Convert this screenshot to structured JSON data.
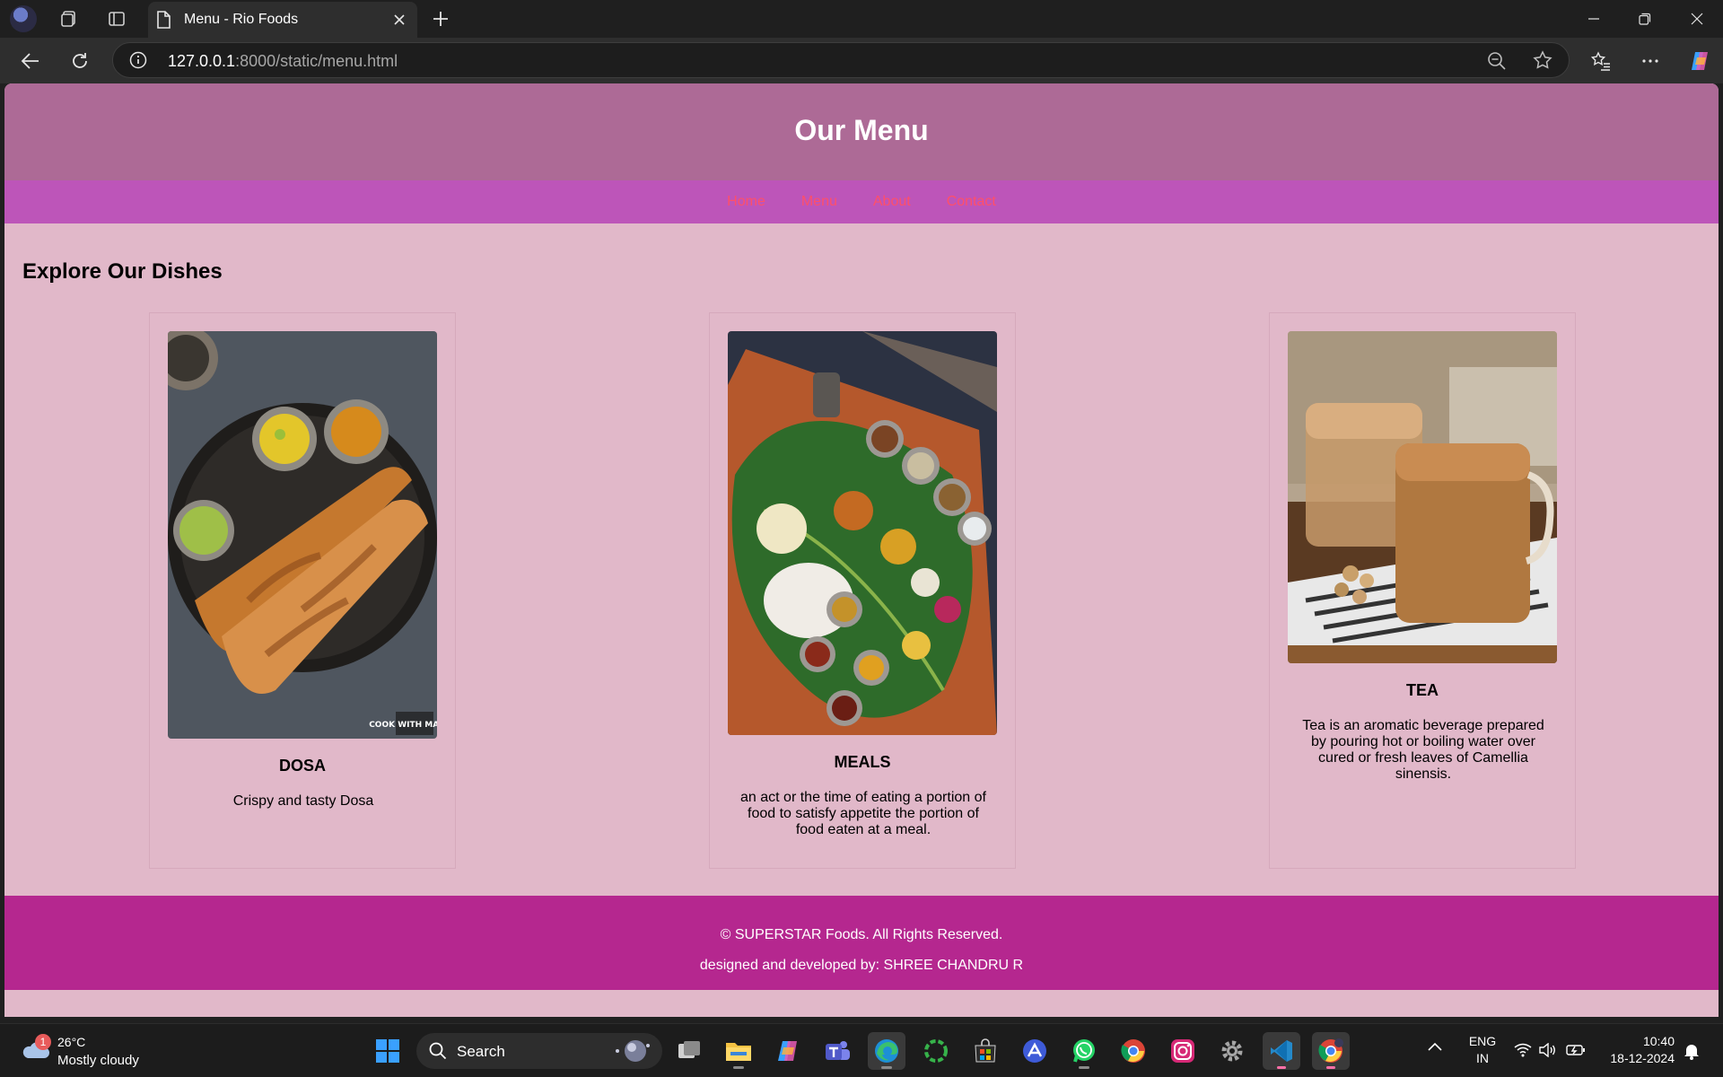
{
  "browser": {
    "tab_title": "Menu - Rio Foods",
    "url_host": "127.0.0.1",
    "url_rest": ":8000/static/menu.html"
  },
  "page": {
    "header_title": "Our Menu",
    "nav": [
      "Home",
      "Menu",
      "About",
      "Contact"
    ],
    "section_heading": "Explore Our Dishes",
    "dishes": [
      {
        "name": "DOSA",
        "description": "Crispy and tasty Dosa",
        "photo_watermark": "COOK WITH MANALI"
      },
      {
        "name": "MEALS",
        "description": "an act or the time of eating a portion of food to satisfy appetite the portion of food eaten at a meal."
      },
      {
        "name": "TEA",
        "description": "Tea is an aromatic beverage prepared by pouring hot or boiling water over cured or fresh leaves of Camellia sinensis."
      }
    ],
    "footer_copyright": "© SUPERSTAR Foods. All Rights Reserved.",
    "footer_credit": "designed and developed by: SHREE CHANDRU R"
  },
  "taskbar": {
    "weather_badge": "1",
    "weather_temp": "26°C",
    "weather_condition": "Mostly cloudy",
    "search_label": "Search",
    "lang_top": "ENG",
    "lang_bottom": "IN",
    "time": "10:40",
    "date": "18-12-2024"
  },
  "colors": {
    "page_background": "#e1b8c9",
    "header_background": "#ad6a96",
    "nav_background": "#bd55b9",
    "nav_link": "#ff4f6a",
    "footer_background": "#b5278f"
  }
}
